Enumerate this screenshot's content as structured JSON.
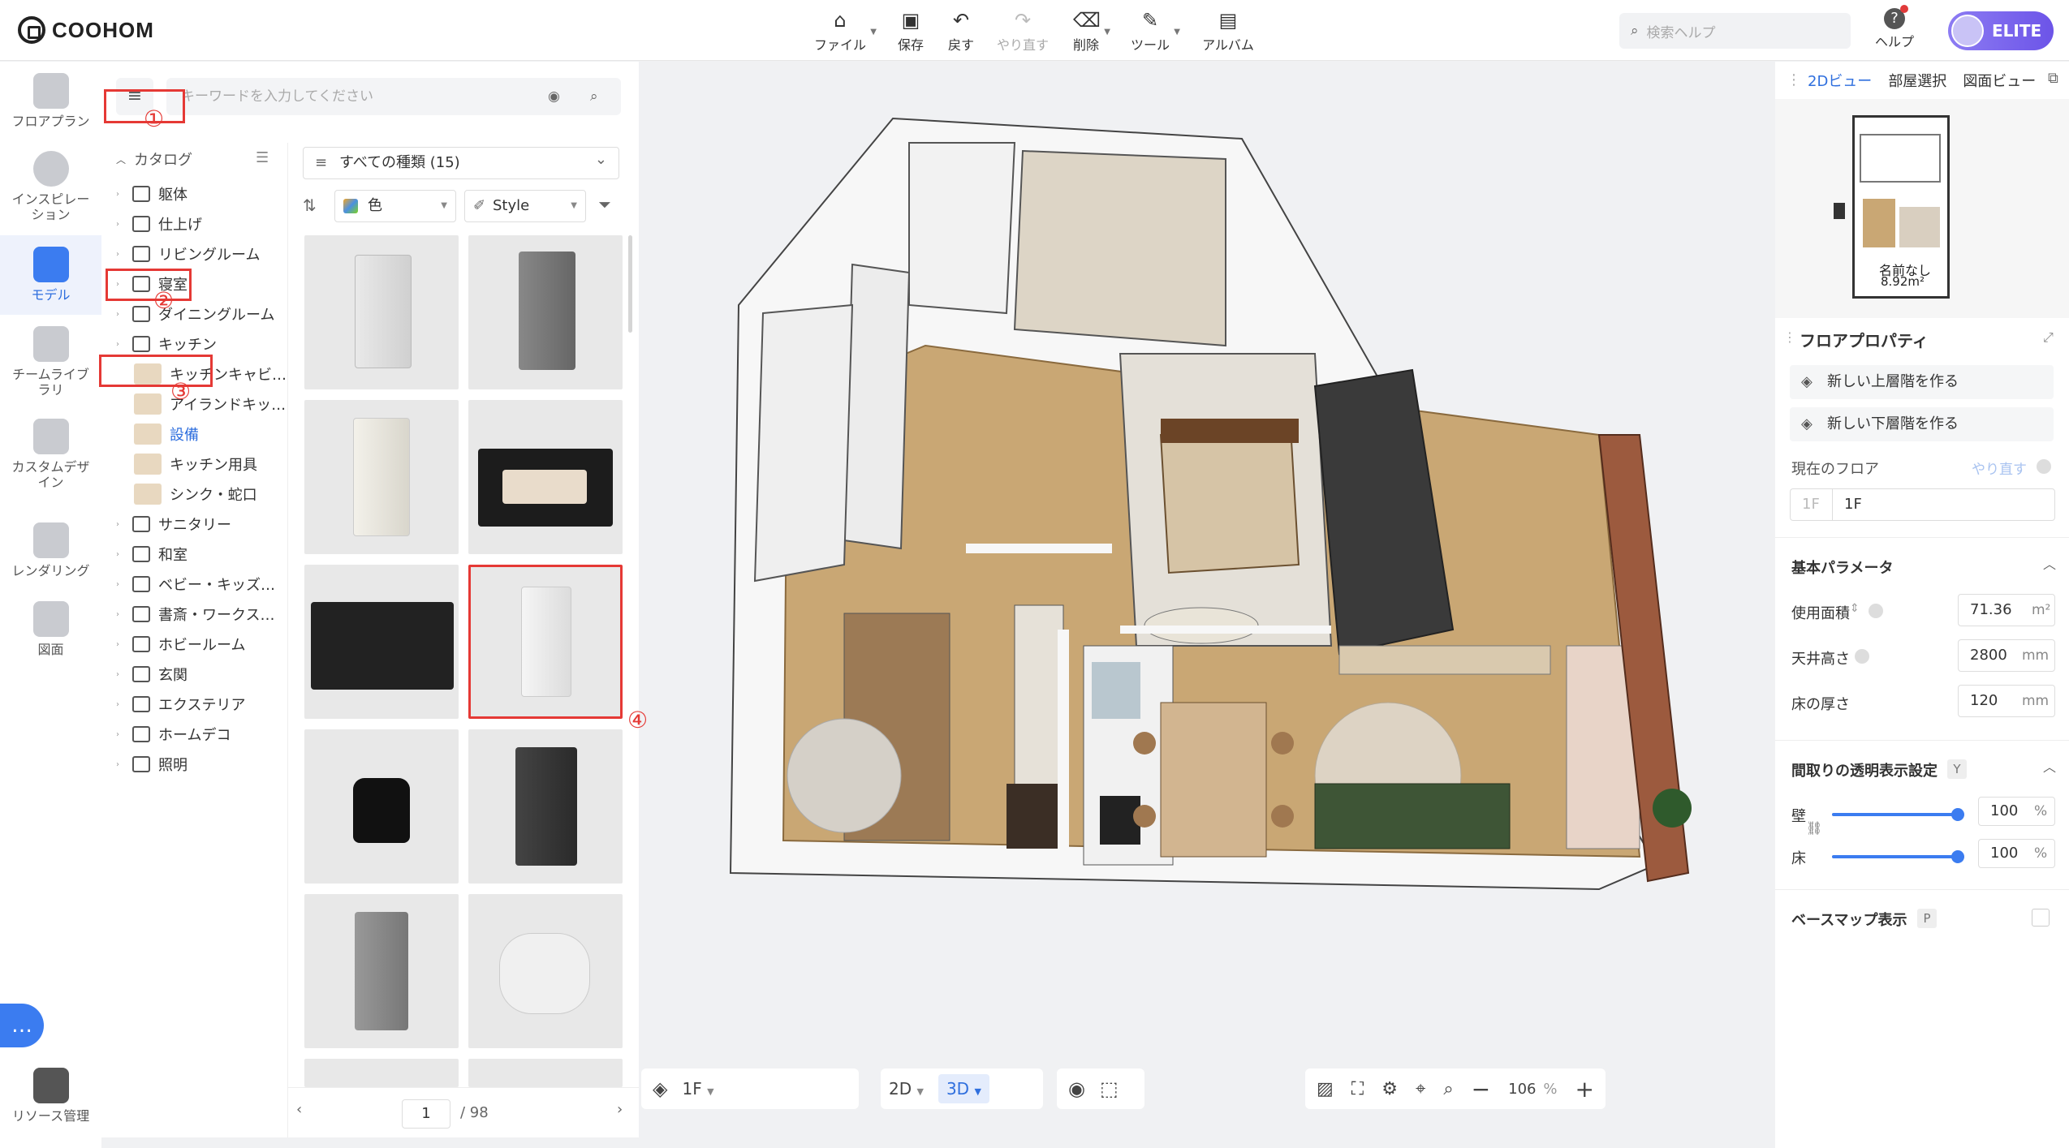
{
  "brand": "COOHOM",
  "toolbar": {
    "file": "ファイル",
    "save": "保存",
    "undo": "戻す",
    "redo": "やり直す",
    "delete": "削除",
    "tools": "ツール",
    "album": "アルバム"
  },
  "header": {
    "search_placeholder": "検索ヘルプ",
    "help": "ヘルプ",
    "elite": "ELITE"
  },
  "rail": {
    "floorplan": "フロアプラン",
    "inspiration": "インスピレーション",
    "model": "モデル",
    "team_library": "チームライブラリ",
    "custom_design": "カスタムデザイン",
    "rendering": "レンダリング",
    "drawings": "図面",
    "resource_mgmt": "リソース管理"
  },
  "catalog": {
    "search_placeholder": "キーワードを入力してください",
    "header": "カタログ",
    "items": [
      "躯体",
      "仕上げ",
      "リビングルーム",
      "寝室",
      "ダイニングルーム",
      "キッチン",
      "キッチンキャビ…",
      "アイランドキッ…",
      "設備",
      "キッチン用具",
      "シンク・蛇口",
      "サニタリー",
      "和室",
      "ベビー・キッズ…",
      "書斎・ワークス…",
      "ホビールーム",
      "玄関",
      "エクステリア",
      "ホームデコ",
      "照明"
    ],
    "type_filter": "すべての種類 (15)",
    "color_filter": "色",
    "style_filter": "Style",
    "page_current": "1",
    "page_total": "/ 98",
    "annotations": [
      "①",
      "②",
      "③",
      "④"
    ]
  },
  "viewport": {
    "floor": "1F",
    "view_2d": "2D",
    "view_3d": "3D",
    "zoom": "106",
    "zoom_unit": "%"
  },
  "right_panel": {
    "tabs": [
      "2Dビュー",
      "部屋選択",
      "図面ビュー"
    ],
    "minimap_label": "名前なし",
    "minimap_area": "8.92m²",
    "title": "フロアプロパティ",
    "btn_upper": "新しい上層階を作る",
    "btn_lower": "新しい下層階を作る",
    "current_floor_label": "現在のフロア",
    "undo_link": "やり直す",
    "floor_prefix": "1F",
    "floor_name": "1F",
    "basic_params": "基本パラメータ",
    "area_label": "使用面積",
    "area_value": "71.36",
    "area_unit": "m²",
    "ceiling_label": "天井高さ",
    "ceiling_value": "2800",
    "ceiling_unit": "mm",
    "floor_thick_label": "床の厚さ",
    "floor_thick_value": "120",
    "floor_thick_unit": "mm",
    "transparency_label": "間取りの透明表示設定",
    "transparency_key": "Y",
    "wall_label": "壁",
    "wall_value": "100",
    "floor_label": "床",
    "floor_value": "100",
    "percent": "%",
    "basemap_label": "ベースマップ表示",
    "basemap_key": "P",
    "wall_level": 1.0,
    "floor_level": 1.0
  }
}
